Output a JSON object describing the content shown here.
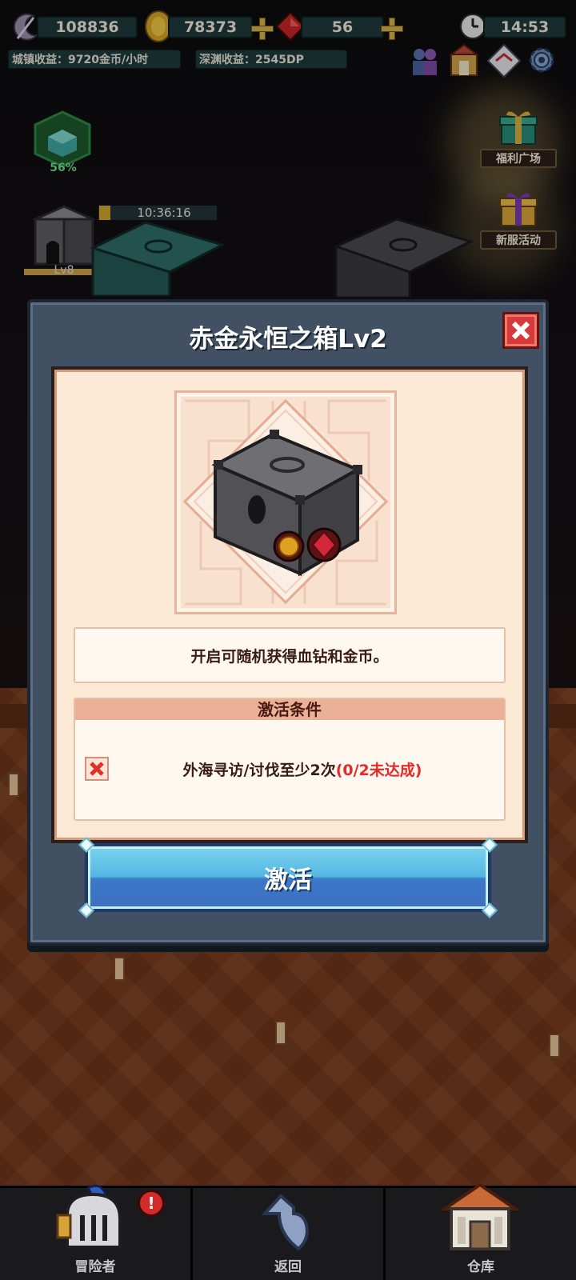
{
  "hud": {
    "souls": "108836",
    "gold": "78373",
    "gems": "56",
    "time": "14:53",
    "town_income": "城镇收益：9720金币/小时",
    "abyss_income": "深渊收益：2545DP"
  },
  "scene": {
    "progress_label": "56%",
    "timer": "10:36:16",
    "building_level": "Lv8"
  },
  "side_menu": {
    "welfare": "福利广场",
    "new_server": "新服活动"
  },
  "modal": {
    "title": "赤金永恒之箱Lv2",
    "description": "开启可随机获得血钻和金币。",
    "conditions_header": "激活条件",
    "condition_text": "外海寻访/讨伐至少2次",
    "condition_status": "(0/2未达成)",
    "activate_label": "激活"
  },
  "bottom_nav": {
    "adventurer": "冒险者",
    "back": "返回",
    "warehouse": "仓库",
    "badge": "!"
  },
  "colors": {
    "modal_bg": "#415163",
    "panel_bg": "#fbe9d6",
    "activate_blue": "#53b7e2",
    "status_red": "#e32929",
    "close_red": "#d73a3a"
  }
}
